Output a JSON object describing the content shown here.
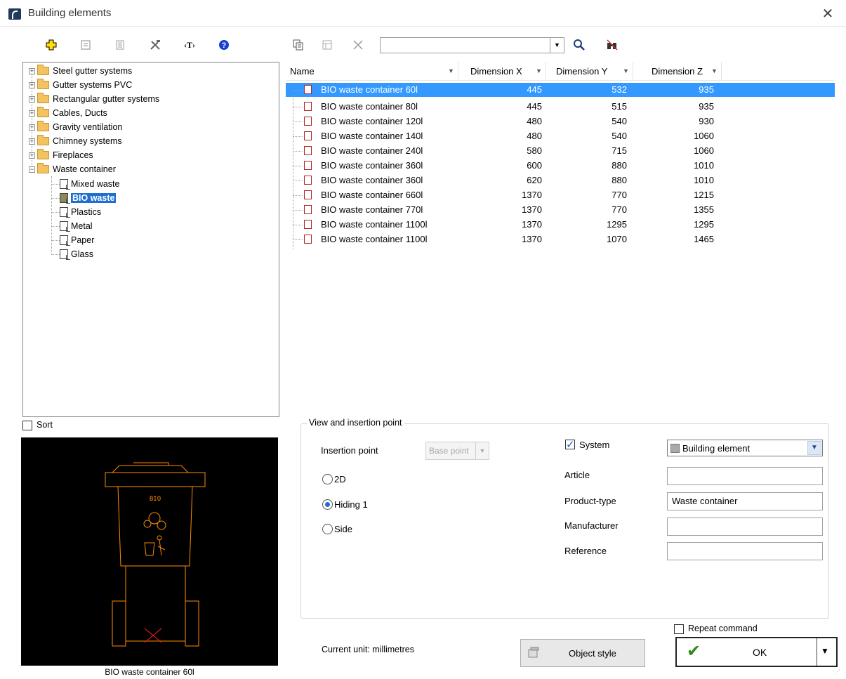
{
  "window": {
    "title": "Building elements",
    "close_glyph": "✕"
  },
  "toolbar": {
    "icons": [
      "add-plus-icon",
      "properties-icon",
      "list-icon",
      "tools-icon",
      "text-tag-icon",
      "help-icon",
      "copy-icon",
      "table-icon",
      "delete-icon",
      "search-icon",
      "binoculars-icon"
    ],
    "search_value": ""
  },
  "tree": {
    "folders": [
      "Steel gutter systems",
      "Gutter systems PVC",
      "Rectangular gutter systems",
      "Cables, Ducts",
      "Gravity ventilation",
      "Chimney systems",
      "Fireplaces",
      "Waste container"
    ],
    "children": [
      "Mixed waste",
      "BIO waste",
      "Plastics",
      "Metal",
      "Paper",
      "Glass"
    ],
    "selected_child": "BIO waste"
  },
  "grid": {
    "columns": [
      "Name",
      "Dimension X",
      "Dimension Y",
      "Dimension Z"
    ],
    "rows": [
      {
        "name": "BIO waste container 60l",
        "x": "445",
        "y": "532",
        "z": "935"
      },
      {
        "name": "BIO waste container 80l",
        "x": "445",
        "y": "515",
        "z": "935"
      },
      {
        "name": "BIO waste container 120l",
        "x": "480",
        "y": "540",
        "z": "930"
      },
      {
        "name": "BIO waste container 140l",
        "x": "480",
        "y": "540",
        "z": "1060"
      },
      {
        "name": "BIO waste container 240l",
        "x": "580",
        "y": "715",
        "z": "1060"
      },
      {
        "name": "BIO waste container 360l",
        "x": "600",
        "y": "880",
        "z": "1010"
      },
      {
        "name": "BIO waste container 360l",
        "x": "620",
        "y": "880",
        "z": "1010"
      },
      {
        "name": "BIO waste container 660l",
        "x": "1370",
        "y": "770",
        "z": "1215"
      },
      {
        "name": "BIO waste container 770l",
        "x": "1370",
        "y": "770",
        "z": "1355"
      },
      {
        "name": "BIO waste container 1100l",
        "x": "1370",
        "y": "1295",
        "z": "1295"
      },
      {
        "name": "BIO waste container 1100l",
        "x": "1370",
        "y": "1070",
        "z": "1465"
      }
    ]
  },
  "sort": {
    "label": "Sort",
    "checked": false
  },
  "preview": {
    "caption": "BIO waste container 60l",
    "drawing_text": "BIO"
  },
  "view_group": {
    "legend": "View and insertion point",
    "insertion_point_label": "Insertion point",
    "insertion_point_value": "Base point",
    "radios": [
      "2D",
      "Hiding 1",
      "Side"
    ],
    "selected_radio": "Hiding 1"
  },
  "properties": {
    "system_label": "System",
    "system_checked": true,
    "system_value": "Building element",
    "article_label": "Article",
    "article_value": "",
    "product_type_label": "Product-type",
    "product_type_value": "Waste container",
    "manufacturer_label": "Manufacturer",
    "manufacturer_value": "",
    "reference_label": "Reference",
    "reference_value": ""
  },
  "footer": {
    "unit_text": "Current unit: millimetres",
    "object_style_label": "Object style",
    "repeat_label": "Repeat command",
    "repeat_checked": false,
    "ok_label": "OK"
  },
  "colors": {
    "selection": "#3399ff",
    "tree_selection": "#1f6fd1",
    "preview_bg": "#000000",
    "drawing": "#ff8c00"
  }
}
